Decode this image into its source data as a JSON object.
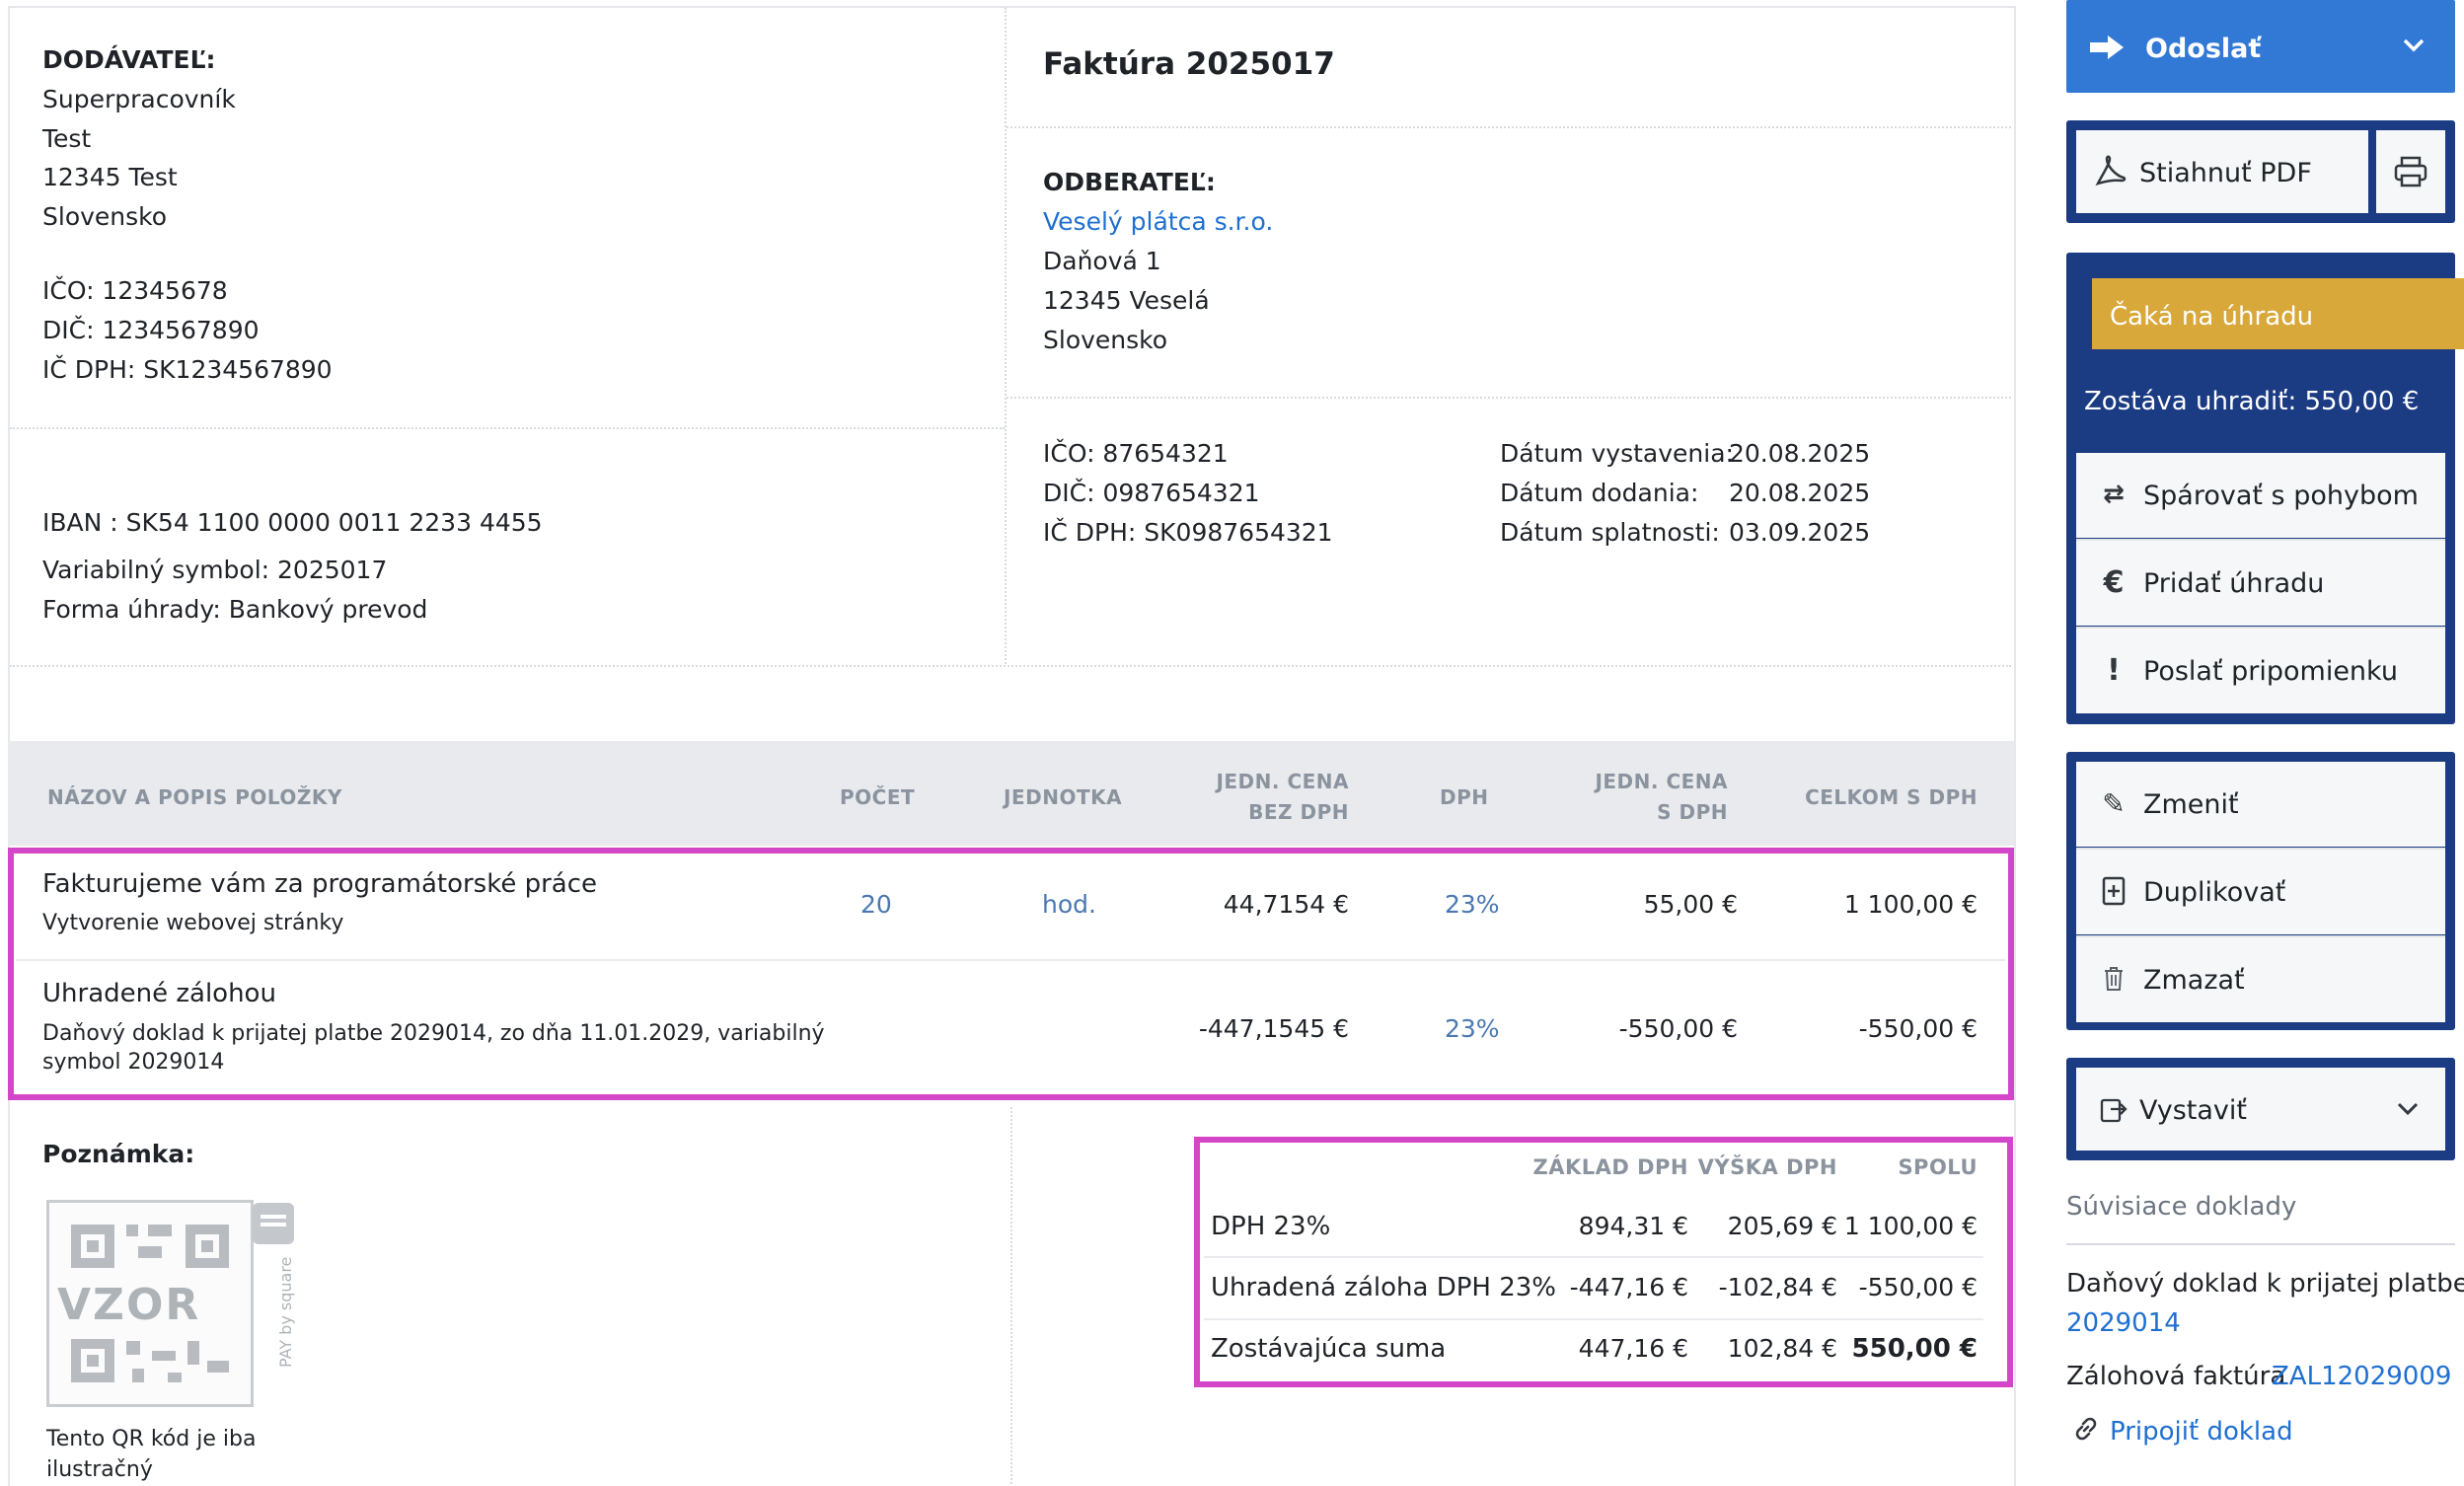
{
  "supplier": {
    "label": "DODÁVATEĽ:",
    "name": "Superpracovník",
    "line2": "Test",
    "city": "12345 Test",
    "country": "Slovensko",
    "ico": "IČO:  12345678",
    "dic": "DIČ:  1234567890",
    "icdph": "IČ DPH:  SK1234567890"
  },
  "payment": {
    "iban": "IBAN : SK54 1100 0000 0011 2233 4455",
    "vs": "Variabilný symbol: 2025017",
    "form": "Forma úhrady: Bankový prevod"
  },
  "invoice": {
    "title": "Faktúra 2025017"
  },
  "customer": {
    "label": "ODBERATEĽ:",
    "name": "Veselý plátca s.r.o.",
    "street": "Daňová 1",
    "city": "12345 Veselá",
    "country": "Slovensko",
    "ico": "IČO: 87654321",
    "dic": "DIČ: 0987654321",
    "icdph": "IČ DPH:  SK0987654321"
  },
  "dates": {
    "issued_label": "Dátum vystavenia:",
    "issued": "20.08.2025",
    "delivery_label": "Dátum dodania:",
    "delivery": "20.08.2025",
    "due_label": "Dátum splatnosti:",
    "due": "03.09.2025"
  },
  "table": {
    "headers": {
      "name": "NÁZOV A POPIS POLOŽKY",
      "qty": "POČET",
      "unit": "JEDNOTKA",
      "price_a": "JEDN. CENA",
      "price_b": "BEZ DPH",
      "vat": "DPH",
      "pricevat_a": "JEDN. CENA",
      "pricevat_b": "S DPH",
      "total": "CELKOM S DPH"
    },
    "rows": [
      {
        "name": "Fakturujeme vám za programátorské práce",
        "desc": "Vytvorenie webovej stránky",
        "qty": "20",
        "unit": "hod.",
        "price": "44,7154 €",
        "vat": "23%",
        "price_vat": "55,00 €",
        "total": "1 100,00 €"
      },
      {
        "name": "Uhradené zálohou",
        "desc1": "Daňový doklad k prijatej platbe 2029014, zo dňa 11.01.2029, variabilný",
        "desc2": "symbol 2029014",
        "qty": "",
        "unit": "",
        "price": "-447,1545 €",
        "vat": "23%",
        "price_vat": "-550,00 €",
        "total": "-550,00 €"
      }
    ]
  },
  "note": {
    "label": "Poznámka:",
    "qr_text": "VZOR",
    "pay_by_square": "PAY by square",
    "qr_caption1": "Tento QR kód je iba",
    "qr_caption2": "ilustračný"
  },
  "summary": {
    "headers": {
      "base": "ZÁKLAD DPH",
      "vat": "VÝŠKA DPH",
      "total": "SPOLU"
    },
    "rows": [
      {
        "label": "DPH 23%",
        "base": "894,31 €",
        "vat": "205,69 €",
        "total": "1 100,00 €"
      },
      {
        "label": "Uhradená záloha DPH 23%",
        "base": "-447,16 €",
        "vat": "-102,84 €",
        "total": "-550,00 €"
      },
      {
        "label": "Zostávajúca suma",
        "base": "447,16 €",
        "vat": "102,84 €",
        "total": "550,00 €"
      }
    ]
  },
  "sidebar": {
    "send": "Odoslať",
    "download_pdf": "Stiahnuť PDF",
    "status": "Čaká na úhradu",
    "remaining": "Zostáva uhradiť: 550,00 €",
    "pair": "Spárovať s pohybom",
    "add_payment": "Pridať úhradu",
    "reminder": "Poslať pripomienku",
    "edit": "Zmeniť",
    "duplicate": "Duplikovať",
    "delete": "Zmazať",
    "issue": "Vystaviť",
    "related_title": "Súvisiace doklady",
    "related1_text": "Daňový doklad k prijatej platbe",
    "related1_link": "2029014",
    "related2_text": "Zálohová faktúra",
    "related2_link": "ZAL12029009",
    "attach": "Pripojiť doklad"
  },
  "colors": {
    "accent_blue": "#3279d6",
    "navy": "#1b3b83",
    "status_yellow": "#d9a83a",
    "highlight": "#d446c8",
    "link": "#1f6fd1"
  }
}
